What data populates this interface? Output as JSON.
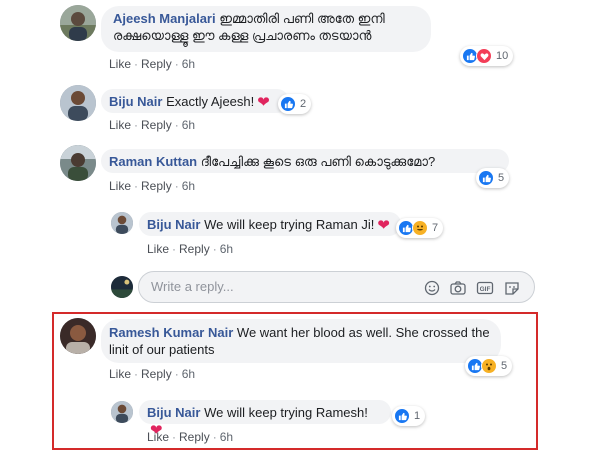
{
  "comments": [
    {
      "author": "Ajeesh Manjalari",
      "text_line1": "ഇമ്മാതിരി പണി അതേ ഇനി",
      "text_line2": "രക്ഷയൊള്ളൂ ഈ കള്ള പ്രചാരണം തടയാൻ",
      "like": "Like",
      "reply": "Reply",
      "time": "6h",
      "reaction_count": "10"
    },
    {
      "author": "Biju Nair",
      "text": "Exactly Ajeesh!",
      "like": "Like",
      "reply": "Reply",
      "time": "6h",
      "reaction_count": "2"
    },
    {
      "author": "Raman Kuttan",
      "text": "ദീപേച്ചിക്കു കൂടെ ഒരു പണി കൊടുക്കുമോ?",
      "like": "Like",
      "reply": "Reply",
      "time": "6h",
      "reaction_count": "5"
    },
    {
      "author": "Biju Nair",
      "text": "We will keep trying Raman Ji!",
      "like": "Like",
      "reply": "Reply",
      "time": "6h",
      "reaction_count": "7"
    },
    {
      "author": "Ramesh Kumar Nair",
      "text_line1": "We want her blood as well. She crossed the",
      "text_line2": "linit of our patients",
      "like": "Like",
      "reply": "Reply",
      "time": "6h",
      "reaction_count": "5"
    },
    {
      "author": "Biju Nair",
      "text": "We will keep trying Ramesh!",
      "like": "Like",
      "reply": "Reply",
      "time": "6h",
      "reaction_count": "1"
    }
  ],
  "reply_box": {
    "placeholder": "Write a reply...",
    "tools": [
      "emoji-icon",
      "camera-icon",
      "gif-icon",
      "sticker-icon"
    ]
  },
  "colors": {
    "author": "#385898",
    "bubble": "#f2f3f5",
    "like_blue": "#1877f2",
    "love_red": "#f33e58",
    "haha_yellow": "#f7b125",
    "highlight_red": "#d42a2a"
  }
}
